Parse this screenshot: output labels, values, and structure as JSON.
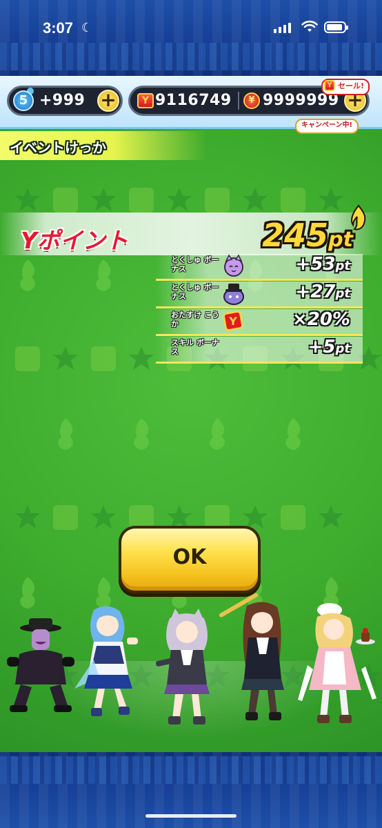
{
  "status_bar": {
    "time": "3:07"
  },
  "header": {
    "level": "5",
    "stamina": "+999",
    "ycoin_count": "9116749",
    "money_count": "9999999",
    "sale_label": "セール!",
    "campaign_label": "キャンペーン中!"
  },
  "title": "イベントけっか",
  "ypoint": {
    "label": "Yポイント",
    "value": "245",
    "unit": "pt"
  },
  "bonuses": [
    {
      "label": "とくしゅ ボーナス",
      "value": "+53",
      "unit": "pt",
      "icon": "purple-cat-yokai-icon"
    },
    {
      "label": "とくしゅ ボーナス",
      "value": "+27",
      "unit": "pt",
      "icon": "purple-hat-yokai-icon"
    },
    {
      "label": "おたすけ こうか",
      "value": "×20%",
      "unit": "",
      "icon": "ycoin-ticket-icon"
    },
    {
      "label": "スキル ボーナス",
      "value": "+5",
      "unit": "pt",
      "icon": ""
    }
  ],
  "ok_button": "OK",
  "colors": {
    "field": "#3eac2e",
    "frame": "#163f95",
    "accent_yellow": "#ffd83b",
    "red": "#e8182e"
  }
}
